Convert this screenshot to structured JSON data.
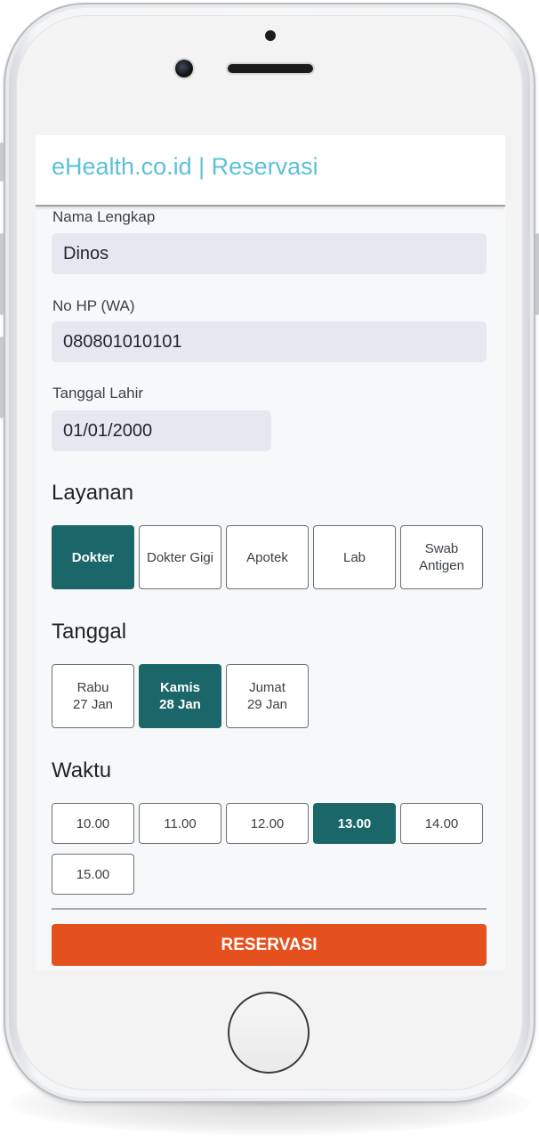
{
  "app": {
    "title": "eHealth.co.id | Reservasi"
  },
  "form": {
    "name": {
      "label": "Nama Lengkap",
      "value": "Dinos"
    },
    "phone": {
      "label": "No HP (WA)",
      "value": "080801010101"
    },
    "birthdate": {
      "label": "Tanggal Lahir",
      "value": "01/01/2000"
    }
  },
  "services": {
    "title": "Layanan",
    "options": [
      {
        "label": "Dokter",
        "selected": true
      },
      {
        "label": "Dokter Gigi",
        "selected": false
      },
      {
        "label": "Apotek",
        "selected": false
      },
      {
        "label": "Lab",
        "selected": false
      },
      {
        "label_line1": "Swab",
        "label_line2": "Antigen",
        "selected": false
      }
    ]
  },
  "dates": {
    "title": "Tanggal",
    "options": [
      {
        "day": "Rabu",
        "date": "27 Jan",
        "selected": false
      },
      {
        "day": "Kamis",
        "date": "28 Jan",
        "selected": true
      },
      {
        "day": "Jumat",
        "date": "29 Jan",
        "selected": false
      }
    ]
  },
  "times": {
    "title": "Waktu",
    "options": [
      {
        "label": "10.00",
        "selected": false
      },
      {
        "label": "11.00",
        "selected": false
      },
      {
        "label": "12.00",
        "selected": false
      },
      {
        "label": "13.00",
        "selected": true
      },
      {
        "label": "14.00",
        "selected": false
      },
      {
        "label": "15.00",
        "selected": false
      }
    ]
  },
  "actions": {
    "reserve_label": "RESERVASI"
  },
  "colors": {
    "title": "#5cc1d8",
    "selected": "#1b6669",
    "reserve_button": "#e4511e",
    "input_bg": "#e5e8ef"
  }
}
